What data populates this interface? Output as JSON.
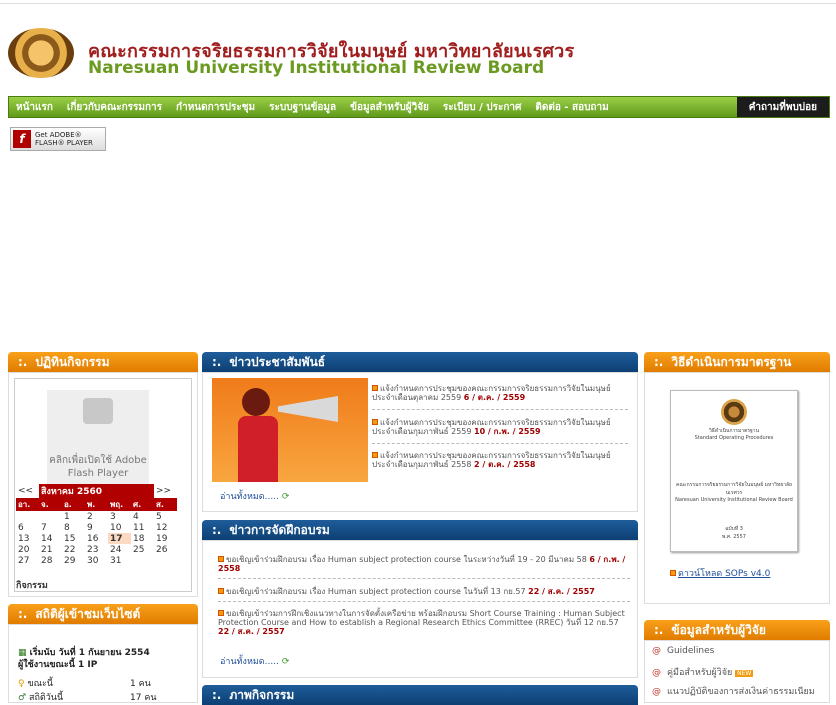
{
  "header": {
    "title_th": "คณะกรรมการจริยธรรมการวิจัยในมนุษย์ มหาวิทยาลัยนเรศวร",
    "title_en": "Naresuan University Institutional Review Board"
  },
  "nav": [
    "หน้าแรก",
    "เกี่ยวกับคณะกรรมการ",
    "กำหนดการประชุม",
    "ระบบฐานข้อมูล",
    "ข้อมูลสำหรับผู้วิจัย",
    "ระเบียบ / ประกาศ",
    "ติดต่อ - สอบถาม",
    "คำถามที่พบบ่อย"
  ],
  "flash": {
    "line1": "Get ADOBE®",
    "line2": "FLASH® PLAYER"
  },
  "activities": {
    "title": "ปฏิทินกิจกรรม",
    "plugin_text": "คลิกเพื่อเปิดใช้ Adobe Flash Player",
    "month": "สิงหาคม 2560",
    "prev": "<<",
    "next": ">>",
    "days": [
      "อา.",
      "จ.",
      "อ.",
      "พ.",
      "พฤ.",
      "ศ.",
      "ส."
    ],
    "weeks": [
      [
        "",
        "",
        "1",
        "2",
        "3",
        "4",
        "5"
      ],
      [
        "6",
        "7",
        "8",
        "9",
        "10",
        "11",
        "12"
      ],
      [
        "13",
        "14",
        "15",
        "16",
        "17",
        "18",
        "19"
      ],
      [
        "20",
        "21",
        "22",
        "23",
        "24",
        "25",
        "26"
      ],
      [
        "27",
        "28",
        "29",
        "30",
        "31",
        "",
        ""
      ]
    ],
    "today": "17",
    "footer": "กิจกรรม"
  },
  "stats": {
    "title": "สถิติผู้เข้าชมเว็บไซต์",
    "since": "เริ่มนับ วันที่ 1 กันยายน 2554",
    "online": "ผู้ใช้งานขณะนี้ 1 IP",
    "rows": [
      {
        "label": "ขณะนี้",
        "value": "1 คน"
      },
      {
        "label": "สถิติวันนี้",
        "value": "17 คน"
      }
    ]
  },
  "news": {
    "title": "ข่าวประชาสัมพันธ์",
    "items": [
      {
        "text": "แจ้งกำหนดการประชุมของคณะกรรมการจริยธรรมการวิจัยในมนุษย์ ประจำเดือนตุลาคม 2559",
        "date": "6 / ต.ค. / 2559"
      },
      {
        "text": "แจ้งกำหนดการประชุมของคณะกรรมการจริยธรรมการวิจัยในมนุษย์ ประจำเดือนกุมภาพันธ์ 2559",
        "date": "10 / ก.พ. / 2559"
      },
      {
        "text": "แจ้งกำหนดการประชุมของคณะกรรมการจริยธรรมการวิจัยในมนุษย์ ประจำเดือนกุมภาพันธ์ 2558",
        "date": "2 / ต.ค. / 2558"
      }
    ],
    "readmore": "อ่านทั้งหมด....."
  },
  "training": {
    "title": "ข่าวการจัดฝึกอบรม",
    "items": [
      {
        "text": "ขอเชิญเข้าร่วมฝึกอบรม เรื่อง Human subject protection course ในระหว่างวันที่ 19 - 20 มีนาคม 58",
        "date": "6 / ก.พ. / 2558"
      },
      {
        "text": "ขอเชิญเข้าร่วมฝึกอบรม เรื่อง Human subject protection course ในวันที่ 13 กย.57",
        "date": "22 / ส.ค. / 2557"
      },
      {
        "text": "ขอเชิญเข้าร่วมการฝึกเชิงแนวทางในการจัดตั้งเครือข่าย พร้อมฝึกอบรม Short Course Training : Human Subject Protection Course and How to establish a Regional Research Ethics Committee (RREC) วันที่ 12 กย.57",
        "date": "22 / ส.ค. / 2557"
      }
    ],
    "readmore": "อ่านทั้งหมด....."
  },
  "gallery": {
    "title": "ภาพกิจกรรม"
  },
  "sop": {
    "title": "วิธีดำเนินการมาตรฐาน",
    "doc_title_th": "วิธีดำเนินการมาตรฐาน",
    "doc_title_en": "Standard Operating Procedures",
    "doc_org_th": "คณะกรรมการจริยธรรมการวิจัยในมนุษย์ มหาวิทยาลัยนเรศวร",
    "doc_org_en": "Naresuan University Institutional Review Board",
    "doc_version": "ฉบับที่ 3",
    "doc_year": "พ.ศ. 2557",
    "link": "ดาวน์โหลด SOPs v4.0"
  },
  "researcher": {
    "title": "ข้อมูลสำหรับผู้วิจัย",
    "items": [
      "Guidelines",
      "คู่มือสำหรับผู้วิจัย",
      "แนวปฏิบัติของการส่งเงินค่าธรรมเนียม"
    ],
    "badge": "NEW"
  }
}
